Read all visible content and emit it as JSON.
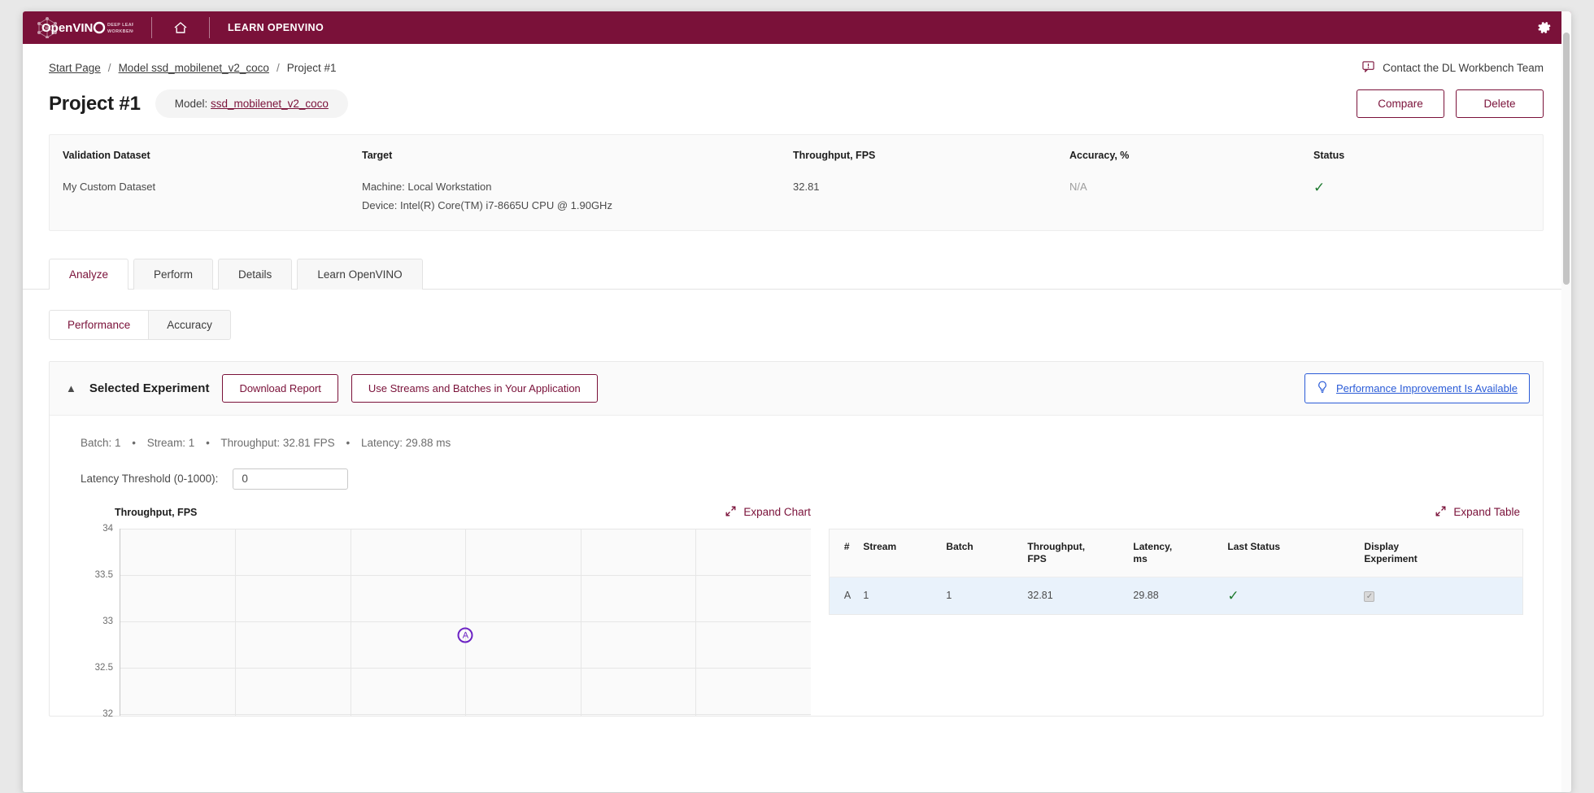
{
  "topbar": {
    "logo_text": "OpenVINO",
    "logo_sub_line1": "DEEP LEARNING",
    "logo_sub_line2": "WORKBENCH",
    "home_icon": "home-icon",
    "learn_label": "LEARN OPENVINO",
    "gear_icon": "gear-icon",
    "bg_color": "#7a1139"
  },
  "breadcrumb": {
    "items": [
      {
        "label": "Start Page",
        "link": true
      },
      {
        "label": "Model ssd_mobilenet_v2_coco",
        "link": true
      },
      {
        "label": "Project #1",
        "link": false
      }
    ],
    "separator": "/"
  },
  "contact": {
    "icon": "feedback-icon",
    "label": "Contact the DL Workbench Team"
  },
  "header": {
    "title": "Project #1",
    "model_prefix": "Model:",
    "model_name": "ssd_mobilenet_v2_coco",
    "compare_label": "Compare",
    "delete_label": "Delete"
  },
  "summary": {
    "headers": [
      "Validation Dataset",
      "Target",
      "Throughput, FPS",
      "Accuracy, %",
      "Status"
    ],
    "row": {
      "dataset": "My Custom Dataset",
      "machine": "Machine: Local Workstation",
      "device": "Device: Intel(R) Core(TM) i7-8665U CPU @ 1.90GHz",
      "throughput": "32.81",
      "accuracy": "N/A",
      "status_icon": "check-icon",
      "status_color": "#1e7a2f"
    }
  },
  "tabs": {
    "items": [
      {
        "label": "Analyze",
        "active": true
      },
      {
        "label": "Perform",
        "active": false
      },
      {
        "label": "Details",
        "active": false
      },
      {
        "label": "Learn OpenVINO",
        "active": false
      }
    ]
  },
  "subtabs": {
    "items": [
      {
        "label": "Performance",
        "active": true
      },
      {
        "label": "Accuracy",
        "active": false
      }
    ]
  },
  "experiment": {
    "caret_icon": "chevron-up-icon",
    "title": "Selected Experiment",
    "download_label": "Download Report",
    "streams_label": "Use Streams and Batches in Your Application",
    "improvement_icon": "lightbulb-icon",
    "improvement_label": "Performance Improvement Is Available",
    "improvement_color": "#2a5bd7",
    "stats": {
      "batch": "Batch: 1",
      "stream": "Stream: 1",
      "throughput": "Throughput: 32.81 FPS",
      "latency": "Latency: 29.88 ms",
      "separator": "•"
    },
    "threshold": {
      "label": "Latency Threshold (0-1000):",
      "value": "0",
      "placeholder": "0"
    },
    "expand_chart_label": "Expand Chart",
    "expand_table_label": "Expand Table",
    "expand_icon": "expand-arrows-icon"
  },
  "chart_data": {
    "type": "scatter",
    "title": "Throughput, FPS",
    "xlabel": "",
    "ylabel": "Throughput, FPS",
    "yticks": [
      34.0,
      33.5,
      33.0,
      32.5,
      32.0
    ],
    "ylim": [
      31.7,
      34.0
    ],
    "xlim": [
      0,
      6
    ],
    "xticks": [
      1,
      2,
      3,
      4,
      5
    ],
    "grid": true,
    "legend": "none",
    "points": [
      {
        "label": "A",
        "x": 3.0,
        "y": 32.85,
        "color": "#6c22c4"
      }
    ]
  },
  "table": {
    "headers": [
      "#",
      "Stream",
      "Batch",
      "Throughput,\nFPS",
      "Latency,\nms",
      "Last Status",
      "Display\nExperiment"
    ],
    "headers_display": [
      {
        "line1": "#",
        "line2": ""
      },
      {
        "line1": "Stream",
        "line2": ""
      },
      {
        "line1": "Batch",
        "line2": ""
      },
      {
        "line1": "Throughput,",
        "line2": "FPS"
      },
      {
        "line1": "Latency,",
        "line2": "ms"
      },
      {
        "line1": "Last Status",
        "line2": ""
      },
      {
        "line1": "Display",
        "line2": "Experiment"
      }
    ],
    "rows": [
      {
        "id": "A",
        "stream": "1",
        "batch": "1",
        "throughput": "32.81",
        "latency": "29.88",
        "last_status": "check-icon",
        "display_experiment_checked": true,
        "selected": true
      }
    ]
  }
}
